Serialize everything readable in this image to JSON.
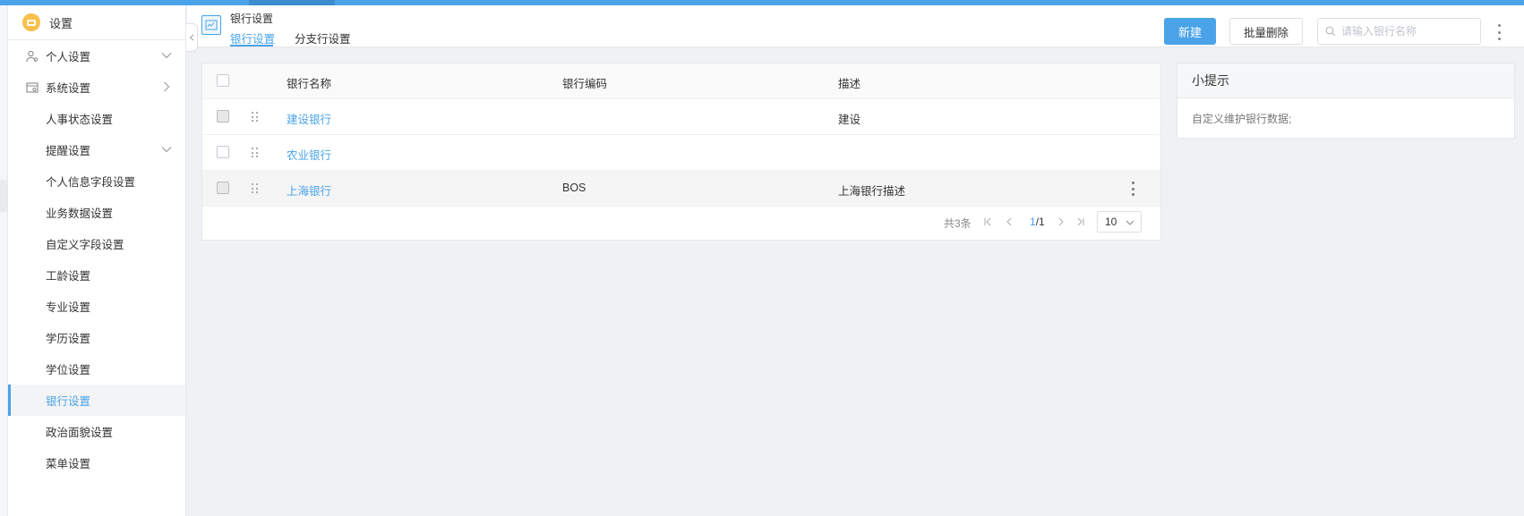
{
  "app": {
    "title": "设置"
  },
  "sidebar": {
    "items": [
      {
        "label": "个人设置",
        "icon": "user-settings-icon",
        "level": "top",
        "chevron": "down"
      },
      {
        "label": "系统设置",
        "icon": "system-settings-icon",
        "level": "top",
        "chevron": "right"
      },
      {
        "label": "人事状态设置",
        "level": "sub"
      },
      {
        "label": "提醒设置",
        "level": "sub",
        "chevron": "down"
      },
      {
        "label": "个人信息字段设置",
        "level": "sub"
      },
      {
        "label": "业务数据设置",
        "level": "sub"
      },
      {
        "label": "自定义字段设置",
        "level": "sub"
      },
      {
        "label": "工龄设置",
        "level": "sub"
      },
      {
        "label": "专业设置",
        "level": "sub"
      },
      {
        "label": "学历设置",
        "level": "sub"
      },
      {
        "label": "学位设置",
        "level": "sub"
      },
      {
        "label": "银行设置",
        "level": "sub",
        "active": true
      },
      {
        "label": "政治面貌设置",
        "level": "sub"
      },
      {
        "label": "菜单设置",
        "level": "sub"
      }
    ]
  },
  "header": {
    "title": "银行设置",
    "tabs": [
      {
        "label": "银行设置",
        "active": true
      },
      {
        "label": "分支行设置",
        "active": false
      }
    ],
    "new_button": "新建",
    "batch_delete_button": "批量删除",
    "search_placeholder": "请输入银行名称"
  },
  "table": {
    "columns": [
      "银行名称",
      "银行编码",
      "描述"
    ],
    "rows": [
      {
        "name": "建设银行",
        "code": "",
        "description": "建设"
      },
      {
        "name": "农业银行",
        "code": "",
        "description": ""
      },
      {
        "name": "上海银行",
        "code": "BOS",
        "description": "上海银行描述"
      }
    ]
  },
  "pagination": {
    "total": "共3条",
    "current": "1",
    "pages": "/1",
    "page_size": "10"
  },
  "tips": {
    "title": "小提示",
    "body": "自定义维护银行数据;"
  },
  "colors": {
    "accent": "#4aa3e8",
    "background": "#eff1f5",
    "logo": "#f7c04c"
  }
}
